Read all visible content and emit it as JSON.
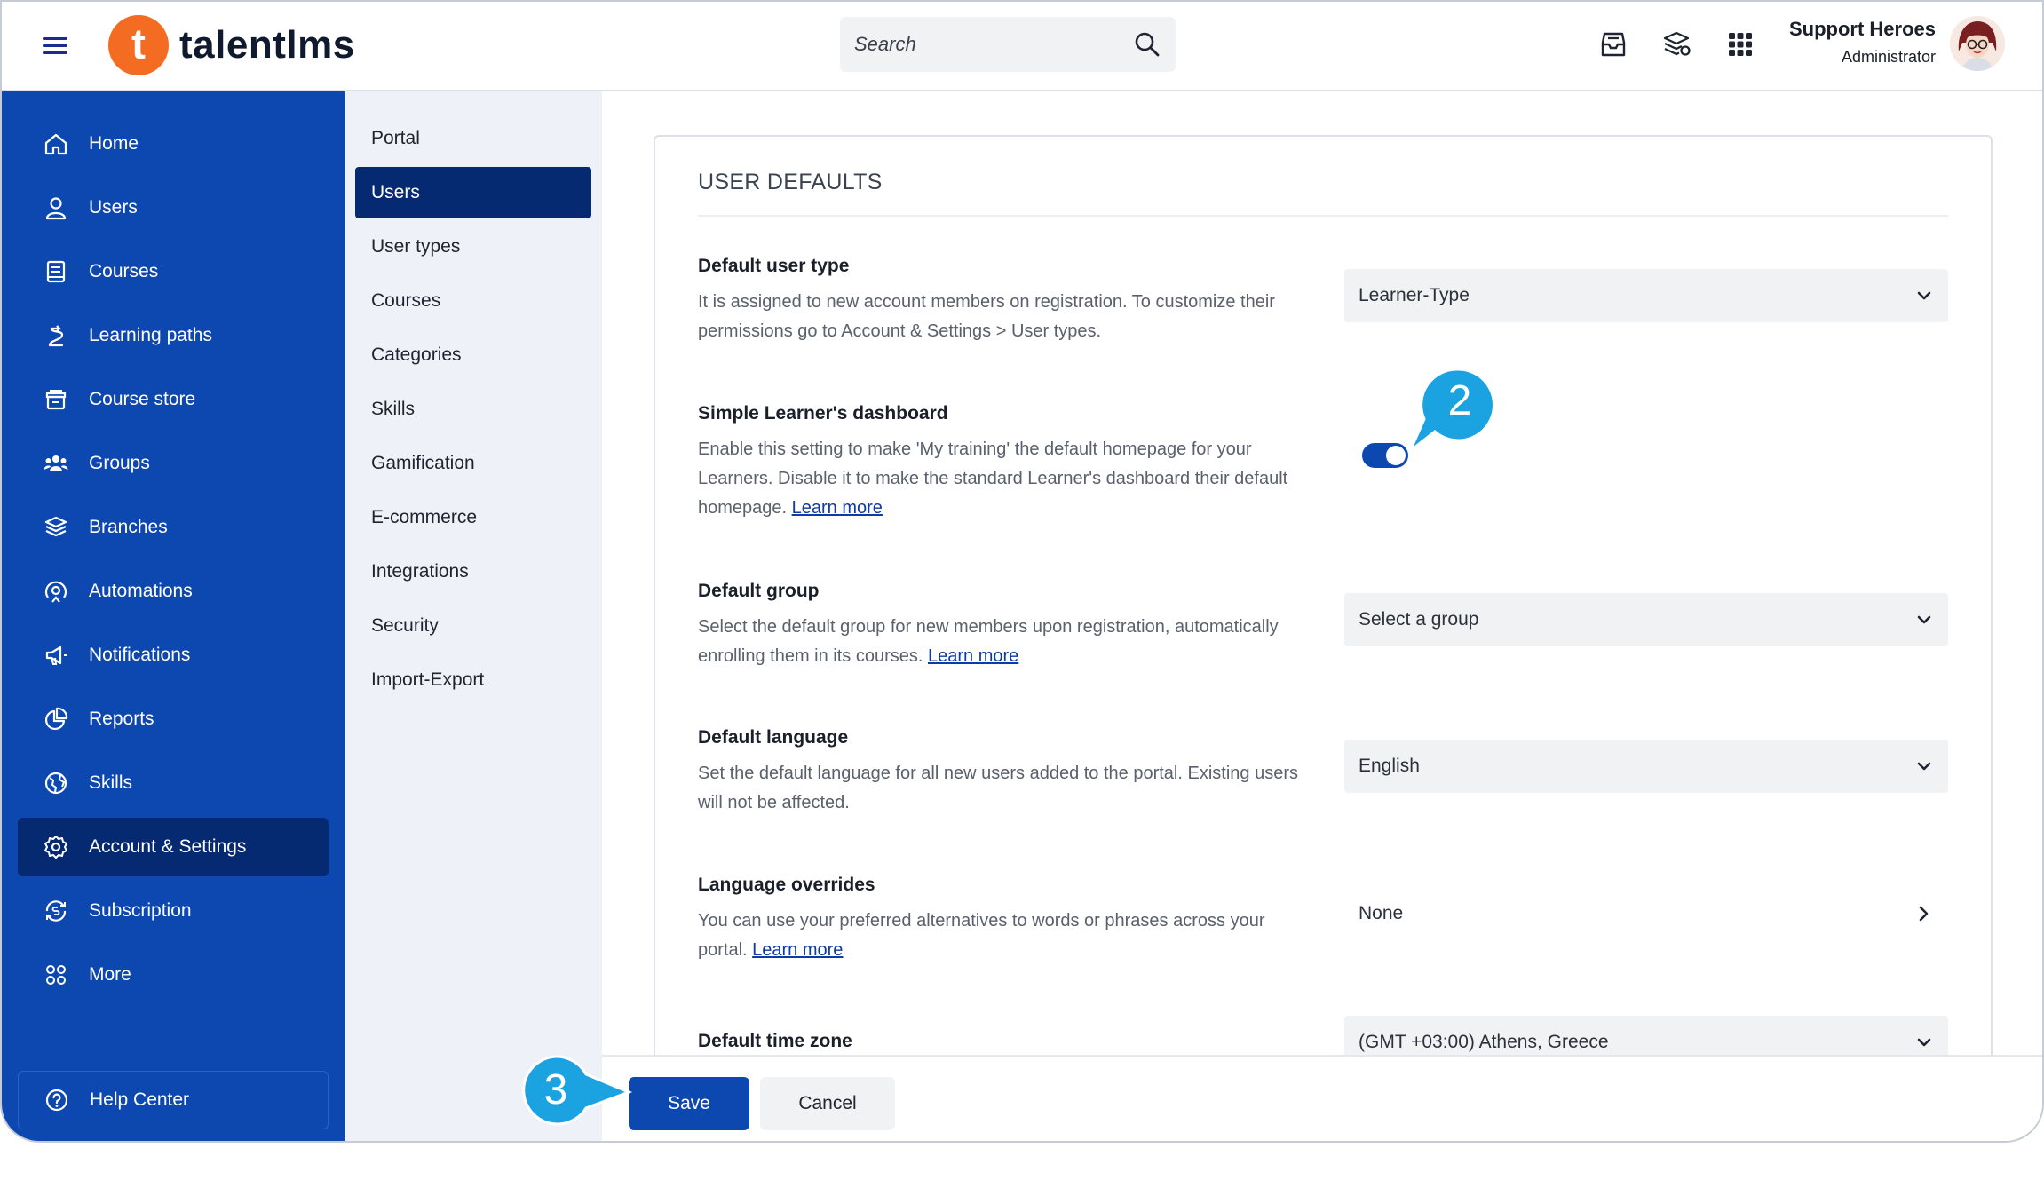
{
  "header": {
    "brand": "talentlms",
    "logo_letter": "t",
    "search_placeholder": "Search",
    "user_name": "Support Heroes",
    "user_role": "Administrator"
  },
  "sidebar": {
    "items": [
      {
        "label": "Home",
        "icon": "home-icon"
      },
      {
        "label": "Users",
        "icon": "user-icon"
      },
      {
        "label": "Courses",
        "icon": "book-icon"
      },
      {
        "label": "Learning paths",
        "icon": "path-icon"
      },
      {
        "label": "Course store",
        "icon": "store-icon"
      },
      {
        "label": "Groups",
        "icon": "groups-icon"
      },
      {
        "label": "Branches",
        "icon": "layers-icon"
      },
      {
        "label": "Automations",
        "icon": "automation-icon"
      },
      {
        "label": "Notifications",
        "icon": "megaphone-icon"
      },
      {
        "label": "Reports",
        "icon": "pie-chart-icon"
      },
      {
        "label": "Skills",
        "icon": "globe-icon"
      },
      {
        "label": "Account & Settings",
        "icon": "gear-icon"
      },
      {
        "label": "Subscription",
        "icon": "subscription-icon"
      },
      {
        "label": "More",
        "icon": "grid-dots-icon"
      }
    ],
    "active_index": 11,
    "help_center": "Help Center"
  },
  "submenu": {
    "items": [
      "Portal",
      "Users",
      "User types",
      "Courses",
      "Categories",
      "Skills",
      "Gamification",
      "E-commerce",
      "Integrations",
      "Security",
      "Import-Export"
    ],
    "active_index": 1
  },
  "card": {
    "title": "USER DEFAULTS",
    "settings": {
      "user_type": {
        "title": "Default user type",
        "desc": "It is assigned to new account members on registration. To customize their permissions go to Account & Settings > User types.",
        "value": "Learner-Type"
      },
      "simple_dashboard": {
        "title": "Simple Learner's dashboard",
        "desc": "Enable this setting to make 'My training' the default homepage for your Learners. Disable it to make the standard Learner's dashboard their default homepage.",
        "link": "Learn more",
        "enabled": true
      },
      "group": {
        "title": "Default group",
        "desc": "Select the default group for new members upon registration, automatically enrolling them in its courses.",
        "link": "Learn more",
        "value": "Select a group"
      },
      "language": {
        "title": "Default language",
        "desc": "Set the default language for all new users added to the portal. Existing users will not be affected.",
        "value": "English"
      },
      "overrides": {
        "title": "Language overrides",
        "desc": "You can use your preferred alternatives to words or phrases across your portal.",
        "link": "Learn more",
        "value": "None"
      },
      "timezone": {
        "title": "Default time zone",
        "value": "(GMT +03:00) Athens, Greece"
      }
    }
  },
  "footer": {
    "save": "Save",
    "cancel": "Cancel"
  },
  "callouts": {
    "step2": "2",
    "step3": "3",
    "color": "#1aa3e0"
  },
  "colors": {
    "sidebar": "#0d48b0",
    "active": "#062a72",
    "brand_orange": "#f36c21"
  }
}
